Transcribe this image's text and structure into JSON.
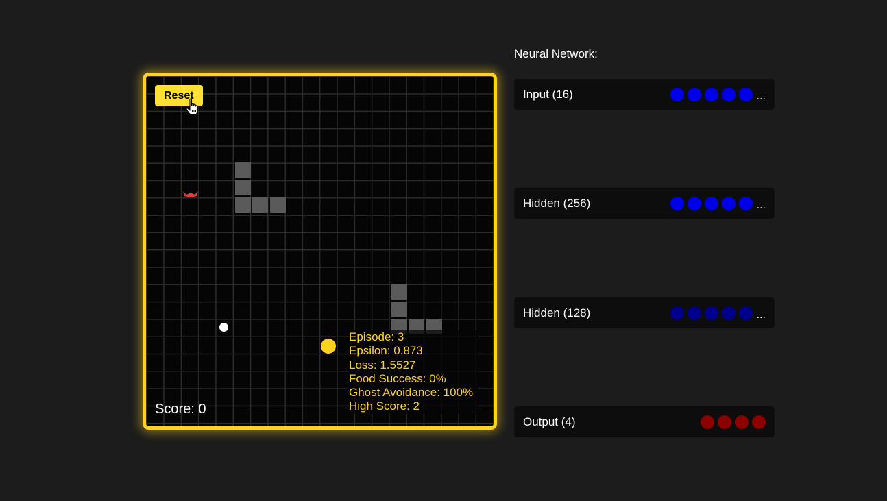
{
  "game": {
    "reset_label": "Reset",
    "score_text": "Score: 0",
    "stats": {
      "episode": "Episode: 3",
      "epsilon": "Epsilon: 0.873",
      "loss": "Loss: 1.5527",
      "food_success": "Food Success: 0%",
      "ghost_avoidance": "Ghost Avoidance: 100%",
      "high_score": "High Score: 2"
    }
  },
  "network": {
    "title": "Neural Network:",
    "layers": [
      {
        "label": "Input (16)",
        "more": "...",
        "color": "#0000e6"
      },
      {
        "label": "Hidden (256)",
        "more": "...",
        "color": "#0000e6"
      },
      {
        "label": "Hidden (128)",
        "more": "...",
        "color": "#00008c"
      },
      {
        "label": "Output (4)",
        "more": "",
        "color": "#8c0000"
      }
    ]
  },
  "colors": {
    "accent": "#ffd21f",
    "wall": "#5a5a5a",
    "ghost": "#e83a3a",
    "pellet": "#ffffff",
    "background": "#1c1c1c"
  }
}
